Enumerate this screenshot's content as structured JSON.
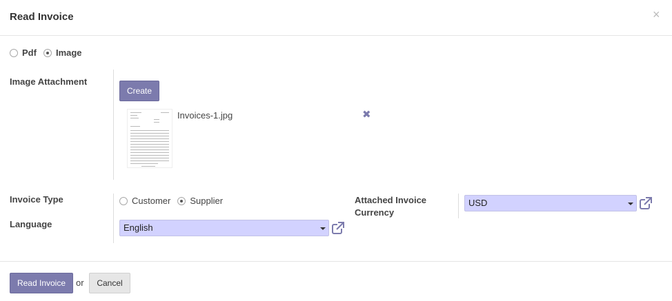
{
  "dialog": {
    "title": "Read Invoice",
    "close_glyph": "×"
  },
  "source": {
    "options": [
      {
        "label": "Pdf",
        "checked": false
      },
      {
        "label": "Image",
        "checked": true
      }
    ]
  },
  "attachment": {
    "label": "Image Attachment",
    "create_label": "Create",
    "file_name": "Invoices-1.jpg",
    "remove_icon": "remove-icon"
  },
  "invoice_type": {
    "label": "Invoice Type",
    "options": [
      {
        "label": "Customer",
        "checked": false
      },
      {
        "label": "Supplier",
        "checked": true
      }
    ]
  },
  "language": {
    "label": "Language",
    "value": "English"
  },
  "currency": {
    "label_line1": "Attached Invoice",
    "label_line2": "Currency",
    "value": "USD"
  },
  "footer": {
    "read_label": "Read Invoice",
    "or_text": "or",
    "cancel_label": "Cancel"
  },
  "colors": {
    "primary": "#7c7bad",
    "select_bg": "#d2d2ff"
  }
}
